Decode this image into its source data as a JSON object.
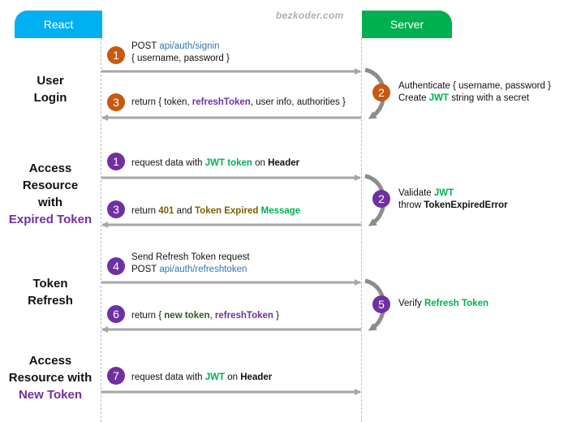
{
  "participants": {
    "client": {
      "label": "React",
      "color": "#00b0f0"
    },
    "server": {
      "label": "Server",
      "color": "#00b050"
    }
  },
  "watermark": "bezkoder.com",
  "colors": {
    "orange_badge": "#c55a11",
    "purple_badge": "#7030a0",
    "link": "#2e75b6",
    "green": "#00b050",
    "purple": "#7030a0",
    "olive": "#7f6000",
    "arrow": "#a6a6a6"
  },
  "sections": [
    {
      "label_lines": [
        "User",
        "Login"
      ],
      "highlight": ""
    },
    {
      "label_lines": [
        "Access",
        "Resource",
        "with"
      ],
      "highlight": "Expired Token"
    },
    {
      "label_lines": [
        "Token",
        "Refresh"
      ],
      "highlight": ""
    },
    {
      "label_lines": [
        "Access",
        "Resource with"
      ],
      "highlight": "New Token"
    }
  ],
  "messages": {
    "login_request": {
      "step": "1",
      "direction": "client-to-server",
      "line1": {
        "prefix": "POST ",
        "link": "api/auth/signin"
      },
      "line2": "{ username, password }"
    },
    "login_process": {
      "step": "2",
      "direction": "self",
      "line1": "Authenticate { username, password }",
      "line2": {
        "prefix": "Create ",
        "hl": "JWT",
        "suffix": " string with a secret"
      }
    },
    "login_response": {
      "step": "3",
      "direction": "server-to-client",
      "parts": [
        "return { token, ",
        "refreshToken",
        ", user info, authorities }"
      ]
    },
    "expired_request": {
      "step": "1",
      "direction": "client-to-server",
      "parts": [
        "request data with ",
        "JWT token",
        " on ",
        "Header"
      ]
    },
    "expired_process": {
      "step": "2",
      "direction": "self",
      "line1": {
        "prefix": "Validate ",
        "hl": "JWT"
      },
      "line2": {
        "prefix": "throw ",
        "hl": "TokenExpiredError"
      }
    },
    "expired_response": {
      "step": "3",
      "direction": "server-to-client",
      "parts": [
        "return ",
        "401",
        " and ",
        "Token Expired",
        " ",
        "Message"
      ]
    },
    "refresh_request": {
      "step": "4",
      "direction": "client-to-server",
      "line1": "Send Refresh Token request",
      "line2": {
        "prefix": "POST ",
        "link": "api/auth/refreshtoken"
      }
    },
    "refresh_process": {
      "step": "5",
      "direction": "self",
      "parts": [
        "Verify ",
        "Refresh Token"
      ]
    },
    "refresh_response": {
      "step": "6",
      "direction": "server-to-client",
      "parts": [
        "return { ",
        "new token",
        ", ",
        "refreshToken",
        " }"
      ]
    },
    "new_request": {
      "step": "7",
      "direction": "client-to-server",
      "parts": [
        "request data with ",
        "JWT",
        " on ",
        "Header"
      ]
    }
  }
}
